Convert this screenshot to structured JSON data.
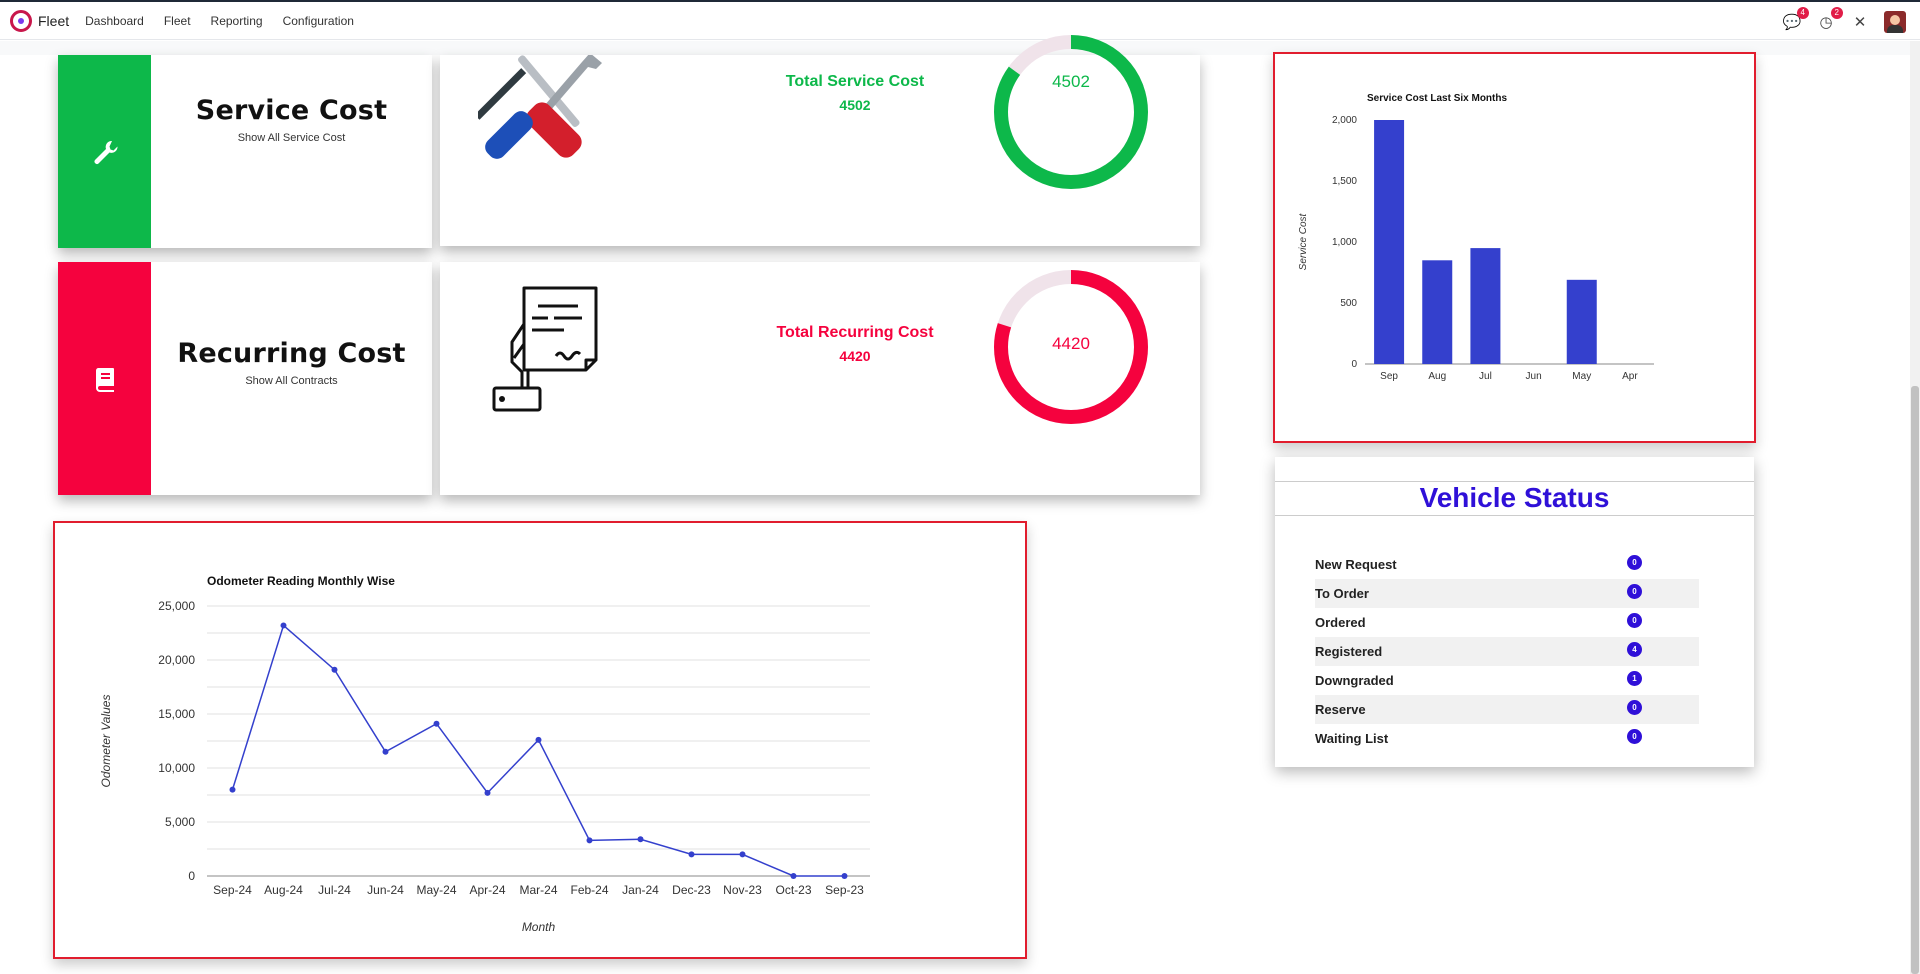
{
  "app": {
    "brand": "Fleet",
    "menu": [
      "Dashboard",
      "Fleet",
      "Reporting",
      "Configuration"
    ],
    "notifications": {
      "messages": "4",
      "activities": "2"
    }
  },
  "service_cost": {
    "title": "Service Cost",
    "link": "Show All Service Cost",
    "total_title": "Total Service Cost",
    "total_value": "4502",
    "ring_value": "4502",
    "ring_fraction": 0.85,
    "color": "#0db84a"
  },
  "recurring_cost": {
    "title": "Recurring Cost",
    "link": "Show All Contracts",
    "total_title": "Total Recurring Cost",
    "total_value": "4420",
    "ring_value": "4420",
    "ring_fraction": 0.8,
    "color": "#f5023e"
  },
  "chart_data": [
    {
      "type": "bar",
      "title": "Service Cost Last Six Months",
      "ylabel": "Service Cost",
      "xlabel": "",
      "categories": [
        "Sep",
        "Aug",
        "Jul",
        "Jun",
        "May",
        "Apr"
      ],
      "values": [
        2000,
        850,
        950,
        0,
        690,
        0
      ],
      "ylim": [
        0,
        2000
      ],
      "yticks": [
        "0",
        "500",
        "1,000",
        "1,500",
        "2,000"
      ],
      "ytick_values": [
        0,
        500,
        1000,
        1500,
        2000
      ],
      "color": "#3440cd"
    },
    {
      "type": "line",
      "title": "Odometer Reading Monthly Wise",
      "xlabel": "Month",
      "ylabel": "Odometer Values",
      "categories": [
        "Sep-24",
        "Aug-24",
        "Jul-24",
        "Jun-24",
        "May-24",
        "Apr-24",
        "Mar-24",
        "Feb-24",
        "Jan-24",
        "Dec-23",
        "Nov-23",
        "Oct-23",
        "Sep-23"
      ],
      "values": [
        8000,
        23200,
        19100,
        11500,
        14100,
        7700,
        12600,
        3300,
        3400,
        2000,
        2000,
        0,
        0
      ],
      "ylim": [
        0,
        25000
      ],
      "yticks": [
        "0",
        "5,000",
        "10,000",
        "15,000",
        "20,000",
        "25,000"
      ],
      "ytick_values": [
        0,
        5000,
        10000,
        15000,
        20000,
        25000
      ],
      "color": "#3440cd"
    }
  ],
  "vehicle_status": {
    "title": "Vehicle Status",
    "items": [
      {
        "label": "New Request",
        "count": "0"
      },
      {
        "label": "To Order",
        "count": "0"
      },
      {
        "label": "Ordered",
        "count": "0"
      },
      {
        "label": "Registered",
        "count": "4"
      },
      {
        "label": "Downgraded",
        "count": "1"
      },
      {
        "label": "Reserve",
        "count": "0"
      },
      {
        "label": "Waiting List",
        "count": "0"
      }
    ]
  }
}
